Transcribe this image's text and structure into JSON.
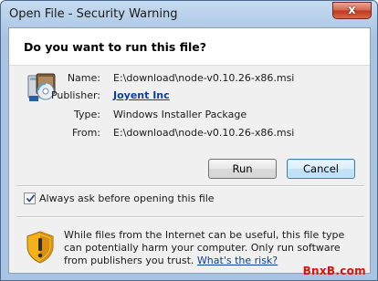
{
  "window": {
    "title": "Open File - Security Warning",
    "close_glyph": "x"
  },
  "prompt": {
    "question": "Do you want to run this file?"
  },
  "file_details": {
    "name_label": "Name:",
    "name_value": "E:\\download\\node-v0.10.26-x86.msi",
    "publisher_label": "Publisher:",
    "publisher_value": "Joyent Inc",
    "type_label": "Type:",
    "type_value": "Windows Installer Package",
    "from_label": "From:",
    "from_value": "E:\\download\\node-v0.10.26-x86.msi",
    "icon": "installer-package-icon"
  },
  "buttons": {
    "run_label": "Run",
    "cancel_label": "Cancel"
  },
  "options": {
    "always_ask_label": "Always ask before opening this file",
    "always_ask_checked": true
  },
  "warning": {
    "icon": "security-shield-icon",
    "text": "While files from the Internet can be useful, this file type can potentially harm your computer. Only run software from publishers you trust.",
    "link": "What's the risk?"
  },
  "watermark": "BnxB.com",
  "colors": {
    "link": "#0a3fa5",
    "close_button": "#c2391d",
    "default_button_border": "#3c7fb1"
  }
}
